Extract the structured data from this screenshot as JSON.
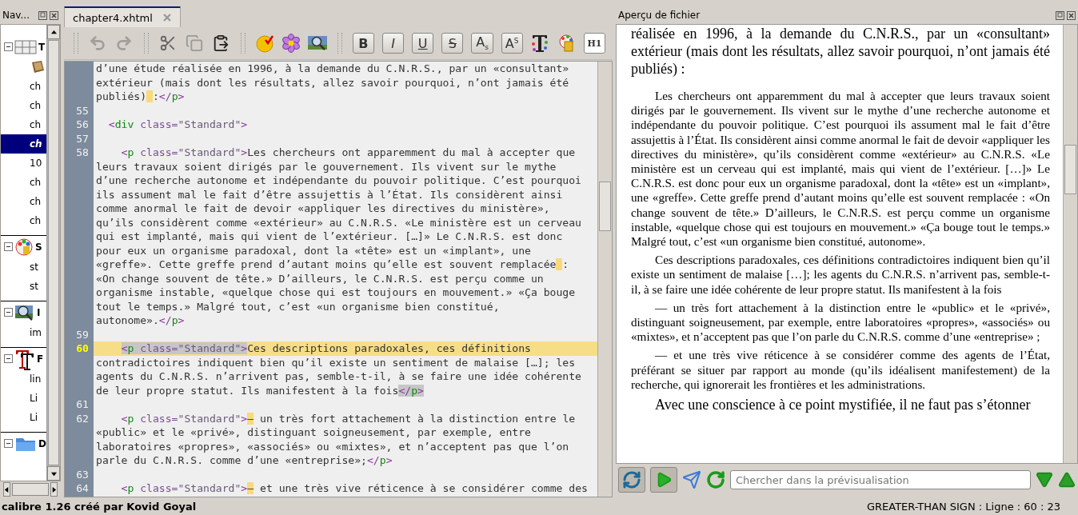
{
  "navigator": {
    "title": "Nav...",
    "groups": [
      {
        "label": "T",
        "expanded": true,
        "children": [
          {
            "kind": "image",
            "selected": false
          },
          {
            "kind": "file",
            "label": "ch",
            "selected": false
          },
          {
            "kind": "file",
            "label": "ch",
            "selected": false
          },
          {
            "kind": "file",
            "label": "ch",
            "selected": false
          },
          {
            "kind": "file",
            "label": "ch",
            "selected": true
          },
          {
            "kind": "file",
            "label": "10",
            "selected": false
          },
          {
            "kind": "file",
            "label": "ch",
            "selected": false
          },
          {
            "kind": "file",
            "label": "ch",
            "selected": false
          },
          {
            "kind": "file",
            "label": "ch",
            "selected": false
          }
        ]
      },
      {
        "label": "S",
        "expanded": true,
        "children": [
          {
            "kind": "file",
            "label": "st",
            "selected": false
          },
          {
            "kind": "file",
            "label": "st",
            "selected": false
          }
        ]
      },
      {
        "label": "I",
        "expanded": true,
        "children": [
          {
            "kind": "file",
            "label": "im",
            "selected": false
          }
        ]
      },
      {
        "label": "F",
        "expanded": true,
        "children": [
          {
            "kind": "file",
            "label": "lin",
            "selected": false
          },
          {
            "kind": "file",
            "label": "Li",
            "selected": false
          },
          {
            "kind": "file",
            "label": "Li",
            "selected": false
          }
        ]
      },
      {
        "label": "D",
        "expanded": true
      }
    ]
  },
  "editor": {
    "tab": {
      "label": "chapter4.xhtml",
      "selected": true
    },
    "toolbar": [
      {
        "kind": "undo",
        "disabled": true
      },
      {
        "kind": "redo",
        "disabled": true
      },
      {
        "kind": "separator"
      },
      {
        "kind": "cut",
        "disabled": false
      },
      {
        "kind": "copy",
        "disabled": false
      },
      {
        "kind": "paste",
        "disabled": false
      },
      {
        "kind": "separator"
      },
      {
        "kind": "check",
        "disabled": false
      },
      {
        "kind": "flower",
        "disabled": false
      },
      {
        "kind": "picture",
        "disabled": false
      },
      {
        "kind": "separator"
      },
      {
        "kind": "bold",
        "label": "B"
      },
      {
        "kind": "italic",
        "label": "I"
      },
      {
        "kind": "underline",
        "label": "U"
      },
      {
        "kind": "strike",
        "label": "S"
      },
      {
        "kind": "subscript",
        "label": "A",
        "script": "s"
      },
      {
        "kind": "superscript",
        "label": "A",
        "script": "S"
      },
      {
        "kind": "textcolor",
        "disabled": false
      },
      {
        "kind": "paint",
        "disabled": false
      },
      {
        "kind": "heading",
        "label": "H1"
      }
    ],
    "blocks": [
      {
        "current": false,
        "lines": [
          "d’une étude réalisée en 1996, à la demande du C.N.R.S., par un «consultant»",
          "extérieur (mais dont les résultats, allez savoir pourquoi, n’ont jamais été",
          [
            {
              "kind": "text",
              "text": "publiés)"
            },
            {
              "kind": "nbsp"
            },
            {
              "kind": "text",
              "text": ":"
            },
            {
              "kind": "bracket",
              "text": "</"
            },
            {
              "kind": "tag",
              "text": "p"
            },
            {
              "kind": "bracket",
              "text": ">"
            }
          ]
        ]
      },
      {
        "number": "55",
        "current": false
      },
      {
        "number": "56",
        "current": false,
        "lines": [
          [
            {
              "kind": "bracket",
              "text": "  <"
            },
            {
              "kind": "tag",
              "text": "div"
            },
            {
              "kind": "attr",
              "text": " class="
            },
            {
              "kind": "string",
              "text": "\"Standard\""
            },
            {
              "kind": "bracket",
              "text": ">"
            }
          ]
        ]
      },
      {
        "number": "57",
        "current": false
      },
      {
        "number": "58",
        "current": false,
        "lines": [
          [
            {
              "kind": "bracket",
              "text": "    <"
            },
            {
              "kind": "tag",
              "text": "p"
            },
            {
              "kind": "attr",
              "text": " class="
            },
            {
              "kind": "string",
              "text": "\"Standard\""
            },
            {
              "kind": "bracket",
              "text": ">"
            },
            {
              "kind": "text",
              "text": "Les chercheurs ont apparemment du mal à accepter que"
            }
          ],
          "leurs travaux soient dirigés par le gouvernement. Ils vivent sur le mythe",
          "d’une recherche autonome et indépendante du pouvoir politique. C’est pourquoi",
          "ils assument mal le fait d’être assujettis à l’État. Ils considèrent ainsi",
          "comme anormal le fait de devoir «appliquer les directives du ministère»,",
          "qu’ils considèrent comme «extérieur» au C.N.R.S. «Le ministère est un cerveau",
          "qui est implanté, mais qui vient de l’extérieur. […]» Le C.N.R.S. est donc",
          "pour eux un organisme paradoxal, dont la «tête» est un «implant», une",
          [
            {
              "kind": "text",
              "text": "«greffe». Cette greffe prend d’autant moins qu’elle est souvent remplacée"
            },
            {
              "kind": "nbsp"
            },
            {
              "kind": "text",
              "text": ":"
            }
          ],
          "«On change souvent de tête.» D’ailleurs, le C.N.R.S. est perçu comme un",
          "organisme instable, «quelque chose qui est toujours en mouvement.» «Ça bouge",
          "tout le temps.» Malgré tout, c’est «un organisme bien constitué,",
          [
            {
              "kind": "text",
              "text": "autonome»."
            },
            {
              "kind": "bracket",
              "text": "</"
            },
            {
              "kind": "tag",
              "text": "p"
            },
            {
              "kind": "bracket",
              "text": ">"
            }
          ]
        ]
      },
      {
        "number": "59",
        "current": false
      },
      {
        "number": "60",
        "current": true,
        "lines": [
          [
            {
              "kind": "indent"
            },
            {
              "kind": "bracket",
              "text": "<",
              "matched": true
            },
            {
              "kind": "tag",
              "text": "p",
              "matched": true
            },
            {
              "kind": "attr",
              "text": " class=",
              "matched": true
            },
            {
              "kind": "string",
              "text": "\"Standard\"",
              "matched": true
            },
            {
              "kind": "bracket",
              "text": ">",
              "matched": true
            },
            {
              "kind": "text",
              "text": "Ces descriptions paradoxales, ces définitions"
            }
          ],
          "contradictoires indiquent bien qu’il existe un sentiment de malaise […]; les",
          "agents du C.N.R.S. n’arrivent pas, semble-t-il, à se faire une idée cohérente",
          [
            {
              "kind": "text",
              "text": "de leur propre statut. Ils manifestent à la fois"
            },
            {
              "kind": "bracket",
              "text": "</",
              "matched": true
            },
            {
              "kind": "tag",
              "text": "p",
              "matched": true
            },
            {
              "kind": "bracket",
              "text": ">",
              "matched": true
            }
          ]
        ]
      },
      {
        "number": "61",
        "current": false
      },
      {
        "number": "62",
        "current": false,
        "lines": [
          [
            {
              "kind": "bracket",
              "text": "    <"
            },
            {
              "kind": "tag",
              "text": "p"
            },
            {
              "kind": "attr",
              "text": " class="
            },
            {
              "kind": "string",
              "text": "\"Standard\""
            },
            {
              "kind": "bracket",
              "text": ">"
            },
            {
              "kind": "mark",
              "text": "—"
            },
            {
              "kind": "text",
              "text": " un très fort attachement à la distinction entre le"
            }
          ],
          "«public» et le «privé», distinguant soigneusement, par exemple, entre",
          "laboratoires «propres», «associés» ou «mixtes», et n’acceptent pas que l’on",
          [
            {
              "kind": "text",
              "text": "parle du C.N.R.S. comme d’une «entreprise»;"
            },
            {
              "kind": "bracket",
              "text": "</"
            },
            {
              "kind": "tag",
              "text": "p"
            },
            {
              "kind": "bracket",
              "text": ">"
            }
          ]
        ]
      },
      {
        "number": "63",
        "current": false
      },
      {
        "number": "64",
        "current": false,
        "lines": [
          [
            {
              "kind": "bracket",
              "text": "    <"
            },
            {
              "kind": "tag",
              "text": "p"
            },
            {
              "kind": "attr",
              "text": " class="
            },
            {
              "kind": "string",
              "text": "\"Standard\""
            },
            {
              "kind": "bracket",
              "text": ">"
            },
            {
              "kind": "mark",
              "text": "—"
            },
            {
              "kind": "text",
              "text": " et une très vive réticence à se considérer comme des"
            }
          ]
        ]
      }
    ]
  },
  "preview": {
    "title": "Aperçu de fichier",
    "paragraphs": [
      {
        "kind": "body",
        "indent": false,
        "text": "réalisée en 1996, à la demande du C.N.R.S., par un «consultant» extérieur (mais dont les résultats, allez savoir pourquoi, n’ont jamais été publiés) :"
      },
      {
        "kind": "quote",
        "indent": true,
        "text": "Les chercheurs ont apparemment du mal à accepter que leurs travaux soient dirigés par le gouvernement. Ils vivent sur le mythe d’une recherche autonome et indépendante du pouvoir politique. C’est pourquoi ils assument mal le fait d’être assujettis à l’État. Ils considèrent ainsi comme anormal le fait de devoir «appliquer les directives du ministère», qu’ils considèrent comme «extérieur» au C.N.R.S. «Le ministère est un cerveau qui est implanté, mais qui vient de l’extérieur. […]» Le C.N.R.S. est donc pour eux un organisme paradoxal, dont la «tête» est un «implant», une «greffe». Cette greffe prend d’autant moins qu’elle est souvent remplacée : «On change souvent de tête.» D’ailleurs, le C.N.R.S. est perçu comme un organisme instable, «quelque chose qui est toujours en mouvement.» «Ça bouge tout le temps.» Malgré tout, c’est «un organisme bien constitué, autonome»."
      },
      {
        "kind": "quote",
        "indent": true,
        "text": "Ces descriptions paradoxales, ces définitions contradictoires indiquent bien qu’il existe un sentiment de malaise […]; les agents du C.N.R.S. n’arrivent pas, semble-t-il, à se faire une idée cohérente de leur propre statut. Ils manifestent à la fois"
      },
      {
        "kind": "quote",
        "indent": true,
        "text": "— un très fort attachement à la distinction entre le «public» et le «privé», distinguant soigneusement, par exemple, entre laboratoires «propres», «associés» ou «mixtes», et n’acceptent pas que l’on parle du C.N.R.S. comme d’une «entreprise» ;"
      },
      {
        "kind": "quote",
        "indent": true,
        "text": "— et une très vive réticence à se considérer comme des agents de l’État, préférant se situer par rapport au monde (qu’ils idéalisent manifestement) de la recherche, qui ignorerait les frontières et les administrations."
      },
      {
        "kind": "body",
        "indent": true,
        "text": "Avec une conscience à ce point mystifiée, il ne faut pas s’étonner"
      }
    ],
    "toolbar": {
      "sync_pressed": true,
      "play_pressed": true,
      "search": {
        "placeholder": "Chercher dans la prévisualisation"
      }
    }
  },
  "status_bar": {
    "left": "calibre 1.26 créé par Kovid Goyal",
    "right": "GREATER-THAN SIGN : Ligne : 60 : 23"
  }
}
